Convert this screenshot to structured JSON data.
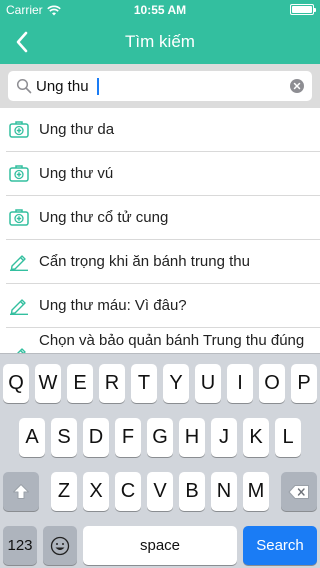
{
  "status_bar": {
    "carrier": "Carrier",
    "time": "10:55 AM"
  },
  "nav": {
    "title": "Tìm kiếm",
    "back_icon": "chevron-left-icon"
  },
  "search": {
    "value": "Ung thu",
    "icon": "search-icon",
    "clear_icon": "clear-icon"
  },
  "results": [
    {
      "text": "Ung thư da",
      "icon": "medical-kit-icon"
    },
    {
      "text": "Ung thư vú",
      "icon": "medical-kit-icon"
    },
    {
      "text": "Ung thư cổ tử cung",
      "icon": "medical-kit-icon"
    },
    {
      "text": "Cẩn trọng khi ăn bánh trung thu",
      "icon": "pencil-icon"
    },
    {
      "text": "Ung thư máu: Vì đâu?",
      "icon": "pencil-icon"
    },
    {
      "text": "Chọn và bảo quản bánh Trung thu đúng",
      "icon": "pencil-icon"
    }
  ],
  "keyboard": {
    "row1": [
      "Q",
      "W",
      "E",
      "R",
      "T",
      "Y",
      "U",
      "I",
      "O",
      "P"
    ],
    "row2": [
      "A",
      "S",
      "D",
      "F",
      "G",
      "H",
      "J",
      "K",
      "L"
    ],
    "row3": [
      "Z",
      "X",
      "C",
      "V",
      "B",
      "N",
      "M"
    ],
    "numbers_label": "123",
    "space_label": "space",
    "search_label": "Search"
  },
  "colors": {
    "accent": "#33bf9f",
    "search_key": "#1a7cf5",
    "keyboard_bg": "#d1d5db"
  }
}
